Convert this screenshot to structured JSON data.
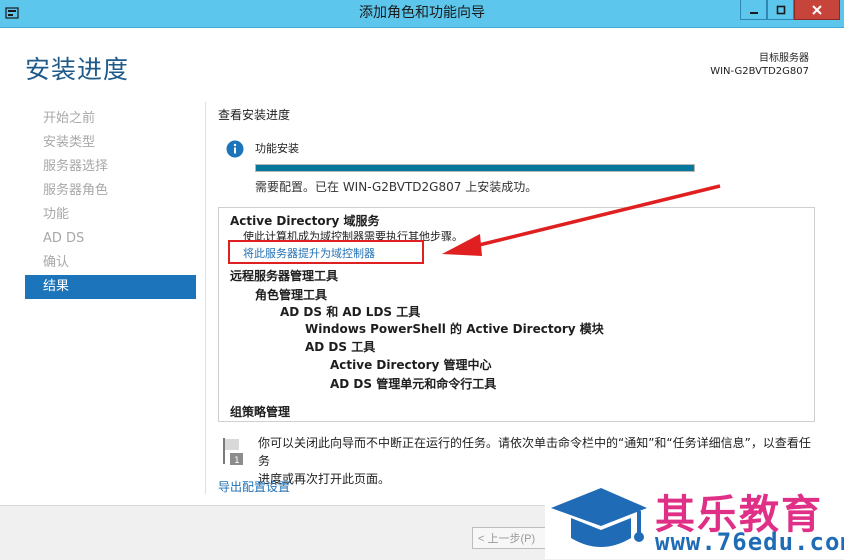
{
  "window": {
    "title": "添加角色和功能向导"
  },
  "header": {
    "page_title": "安装进度",
    "target_label": "目标服务器",
    "target_server": "WIN-G2BVTD2G807"
  },
  "nav": {
    "items": [
      {
        "label": "开始之前"
      },
      {
        "label": "安装类型"
      },
      {
        "label": "服务器选择"
      },
      {
        "label": "服务器角色"
      },
      {
        "label": "功能"
      },
      {
        "label": "AD DS"
      },
      {
        "label": "确认"
      },
      {
        "label": "结果"
      }
    ],
    "active": "结果"
  },
  "content": {
    "heading": "查看安装进度",
    "feature_label": "功能安装",
    "progress_percent": 100,
    "progress_text": "需要配置。已在 WIN-G2BVTD2G807 上安装成功。",
    "results": {
      "ad_title": "Active Directory 域服务",
      "ad_desc": "使此计算机成为域控制器需要执行其他步骤。",
      "ad_link": "将此服务器提升为域控制器",
      "rsat": "远程服务器管理工具",
      "role_tools": "角色管理工具",
      "adds_lds": "AD DS 和 AD LDS 工具",
      "ps_module": "Windows PowerShell 的 Active Directory 模块",
      "adds_tools": "AD DS 工具",
      "ad_admin_center": "Active Directory 管理中心",
      "adds_snapins": "AD DS 管理单元和命令行工具",
      "gpm": "组策略管理"
    },
    "note_line1": "你可以关闭此向导而不中断正在运行的任务。请依次单击命令栏中的“通知”和“任务详细信息”，以查看任务",
    "note_line2": "进度或再次打开此页面。",
    "export_link": "导出配置设置"
  },
  "footer": {
    "prev_button": "< 上一步(P)"
  },
  "watermark": {
    "name": "其乐教育",
    "url": "www.76edu.com"
  },
  "colors": {
    "titlebar": "#5cc6ec",
    "accent": "#1c74bb",
    "progress": "#06789a",
    "highlight": "#e02020",
    "link": "#1f6fb3"
  }
}
